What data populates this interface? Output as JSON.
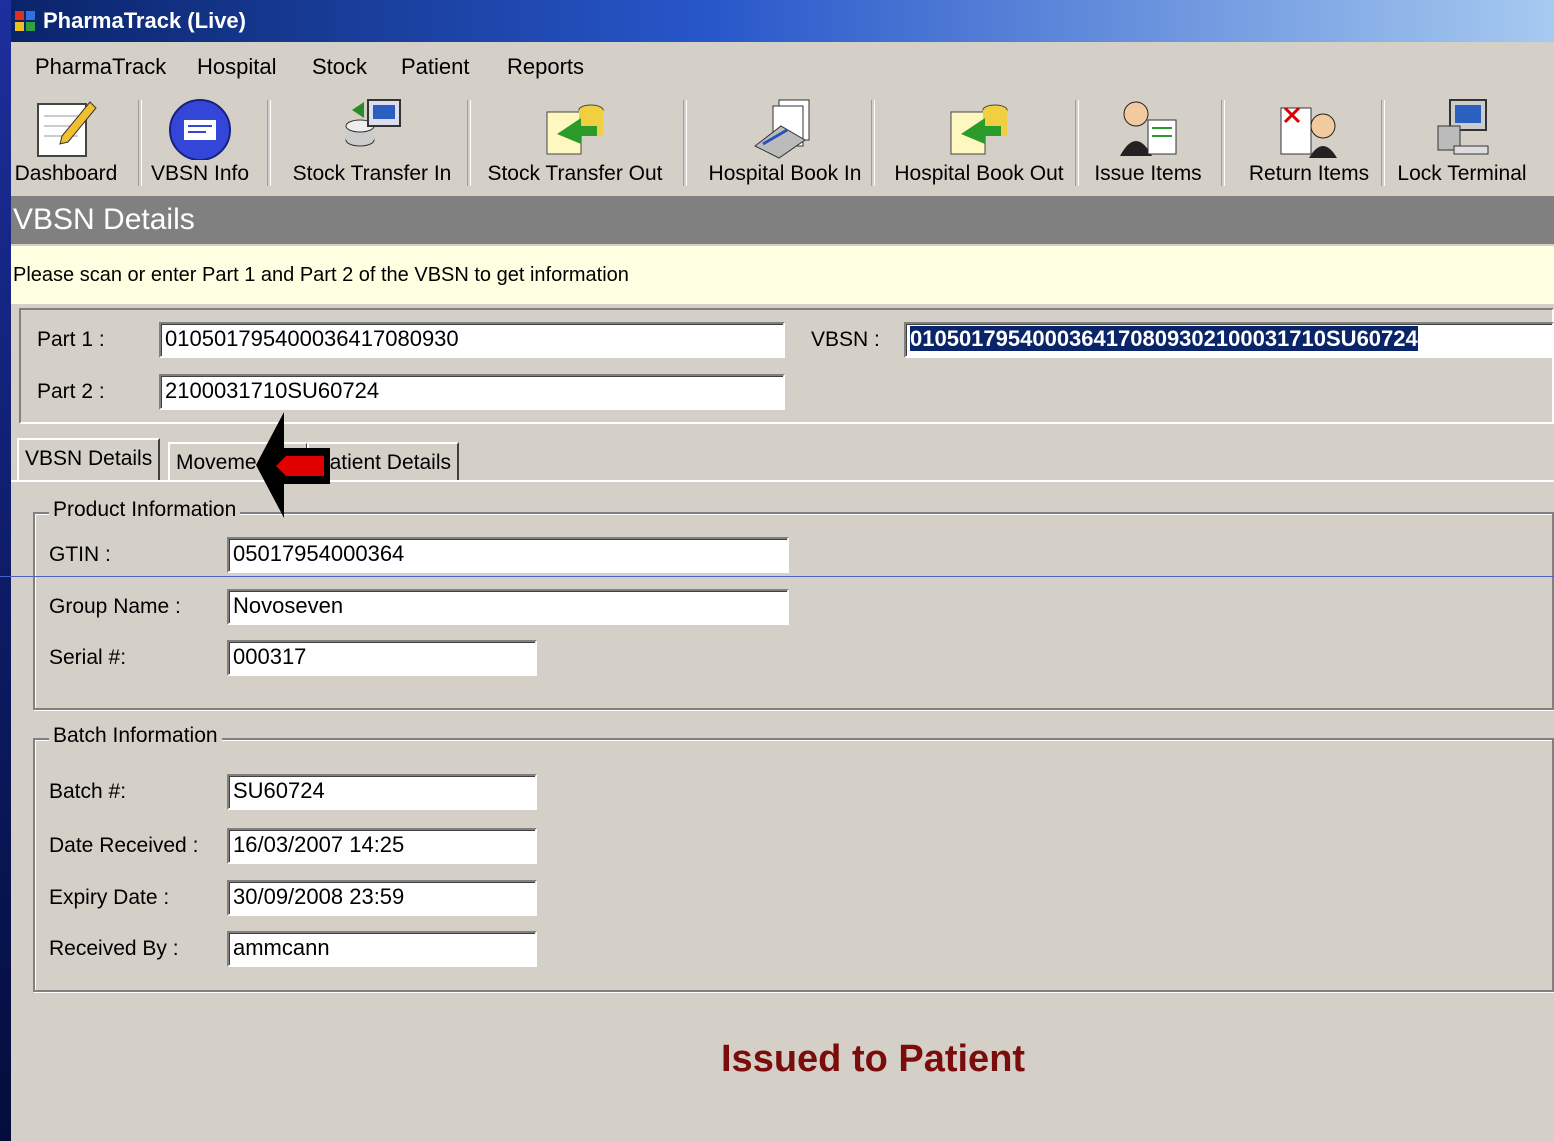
{
  "window": {
    "title": "PharmaTrack (Live)"
  },
  "menu": [
    "PharmaTrack",
    "Hospital",
    "Stock",
    "Patient",
    "Reports"
  ],
  "toolbar": [
    {
      "label": "Dashboard",
      "icon": "notepad-pencil-icon"
    },
    {
      "label": "VBSN Info",
      "icon": "info-card-icon"
    },
    {
      "label": "Stock Transfer In",
      "icon": "database-transfer-in-icon"
    },
    {
      "label": "Stock Transfer Out",
      "icon": "document-transfer-out-icon"
    },
    {
      "label": "Hospital Book In",
      "icon": "scanner-documents-icon"
    },
    {
      "label": "Hospital Book Out",
      "icon": "document-book-out-icon"
    },
    {
      "label": "Issue Items",
      "icon": "people-document-icon"
    },
    {
      "label": "Return Items",
      "icon": "return-checklist-icon"
    },
    {
      "label": "Lock Terminal",
      "icon": "computer-lock-icon"
    }
  ],
  "section": {
    "title": "VBSN Details"
  },
  "info": {
    "text": "Please scan or enter Part 1 and Part 2 of the VBSN to get information"
  },
  "scan": {
    "part1_label": "Part 1 :",
    "part1_value": "01050179540003641708093​0",
    "part2_label": "Part 2 :",
    "part2_value": "2100031710SU60724",
    "vbsn_label": "VBSN :",
    "vbsn_value": "0105017954000364170809302100031710SU60724"
  },
  "tabs": [
    "VBSN Details",
    "Moveme",
    "atient Details"
  ],
  "product": {
    "legend": "Product Information",
    "gtin_label": "GTIN :",
    "gtin_value": "05017954000364",
    "group_label": "Group Name :",
    "group_value": "Novoseven",
    "serial_label": "Serial #:",
    "serial_value": "000317"
  },
  "batch": {
    "legend": "Batch Information",
    "batch_label": "Batch #:",
    "batch_value": "SU60724",
    "received_label": "Date Received :",
    "received_value": "16/03/2007 14:25",
    "expiry_label": "Expiry Date :",
    "expiry_value": "30/09/2008 23:59",
    "by_label": "Received By :",
    "by_value": "ammcann"
  },
  "status": {
    "text": "Issued to Patient",
    "color": "#7b0c0c"
  },
  "colors": {
    "accent": "#0a246a",
    "infobar": "#ffffe1",
    "header": "#808080",
    "arrow": "#e00000"
  }
}
